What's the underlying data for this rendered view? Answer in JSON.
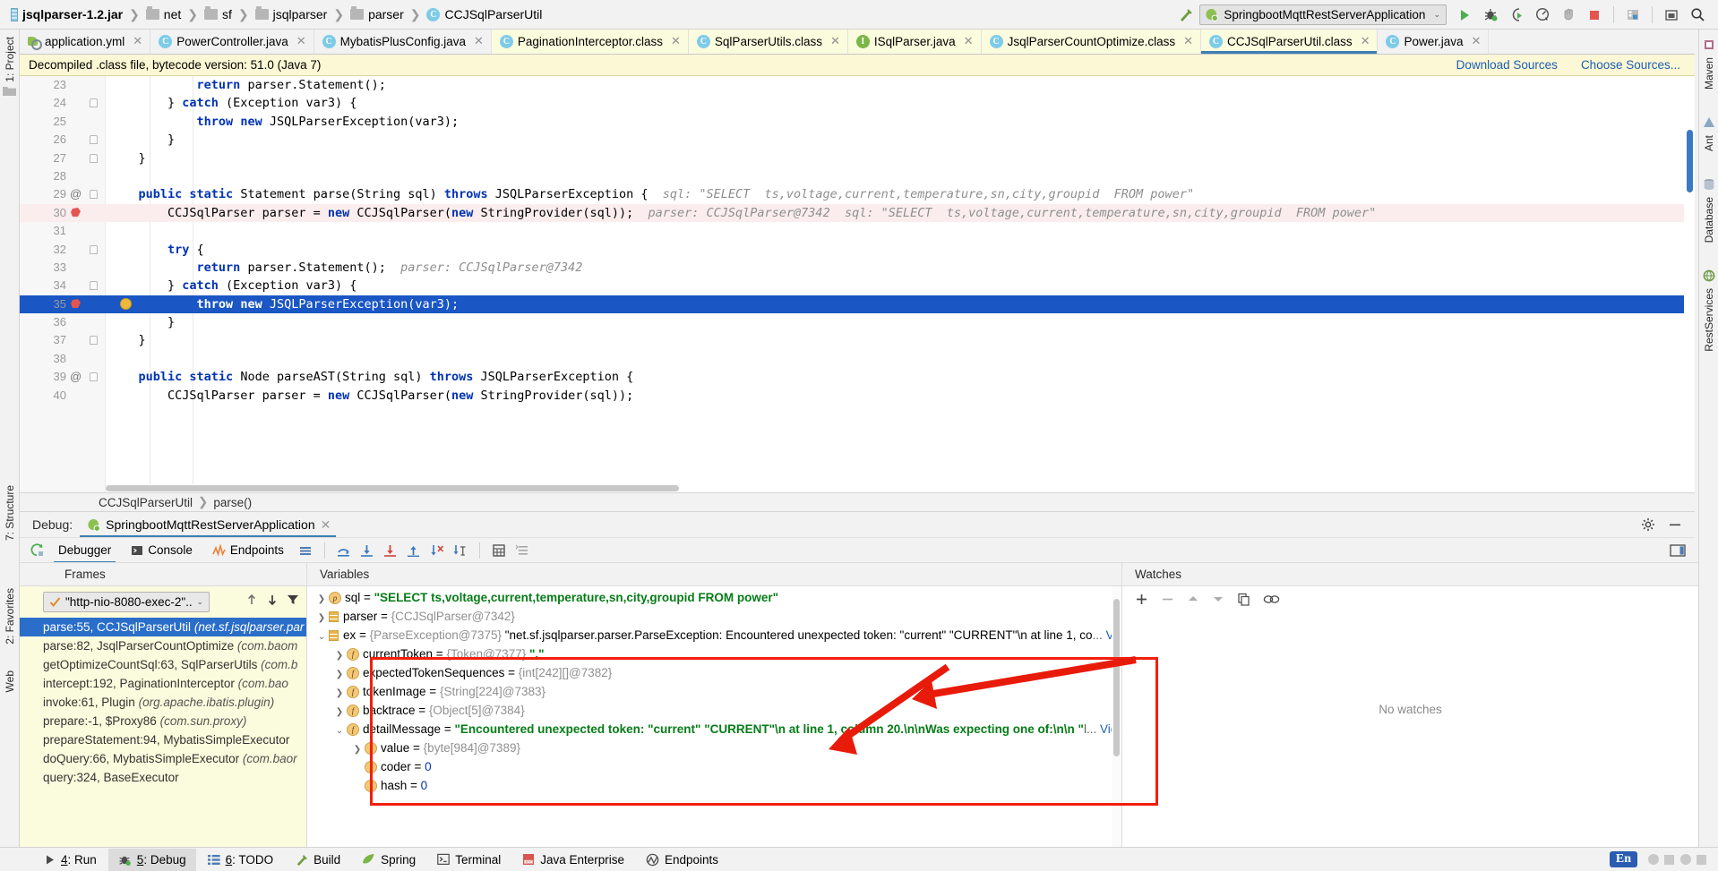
{
  "breadcrumb": {
    "items": [
      {
        "label": "jsqlparser-1.2.jar",
        "icon": "jar-icon"
      },
      {
        "label": "net",
        "icon": "folder-icon"
      },
      {
        "label": "sf",
        "icon": "folder-icon"
      },
      {
        "label": "jsqlparser",
        "icon": "folder-icon"
      },
      {
        "label": "parser",
        "icon": "folder-icon"
      },
      {
        "label": "CCJSqlParserUtil",
        "icon": "class-icon"
      }
    ],
    "separator": "❯"
  },
  "toolbar": {
    "build_icon": "hammer-icon",
    "run_config": "SpringbootMqttRestServerApplication",
    "run_config_icon": "spring-boot-icon",
    "chevron": "⌄",
    "buttons": [
      {
        "name": "run-button",
        "icon": "play-icon"
      },
      {
        "name": "debug-button",
        "icon": "bug-icon"
      },
      {
        "name": "run-with-coverage-button",
        "icon": "run-coverage-icon"
      },
      {
        "name": "profile-button",
        "icon": "profiler-icon"
      },
      {
        "name": "attach-to-process-button",
        "icon": "hand-icon"
      },
      {
        "name": "stop-button",
        "icon": "stop-square-icon"
      },
      {
        "name": "project-structure-button",
        "icon": "project-structure-icon"
      },
      {
        "name": "hide-window-button",
        "icon": "minimize-icon"
      },
      {
        "name": "search-everywhere-button",
        "icon": "search-icon"
      }
    ]
  },
  "editor_tabs": [
    {
      "label": "application.yml",
      "icon": "yml-spring-icon",
      "state": "normal"
    },
    {
      "label": "PowerController.java",
      "icon": "class-icon",
      "state": "normal"
    },
    {
      "label": "MybatisPlusConfig.java",
      "icon": "class-icon",
      "state": "normal"
    },
    {
      "label": "PaginationInterceptor.class",
      "icon": "class-icon",
      "state": "highlight"
    },
    {
      "label": "SqlParserUtils.class",
      "icon": "class-icon",
      "state": "highlight"
    },
    {
      "label": "ISqlParser.java",
      "icon": "interface-icon",
      "state": "highlight"
    },
    {
      "label": "JsqlParserCountOptimize.class",
      "icon": "class-icon",
      "state": "highlight"
    },
    {
      "label": "CCJSqlParserUtil.class",
      "icon": "class-icon",
      "state": "active"
    },
    {
      "label": "Power.java",
      "icon": "class-icon",
      "state": "normal"
    }
  ],
  "notification": {
    "message": "Decompiled .class file, bytecode version: 51.0 (Java 7)",
    "download_sources": "Download Sources",
    "choose_sources": "Choose Sources..."
  },
  "code": {
    "lines": [
      {
        "num": "23",
        "indent": 12,
        "html": "<span class=\"kw\">return</span> parser.Statement();",
        "fold": false
      },
      {
        "num": "24",
        "indent": 8,
        "html": "} <span class=\"kw\">catch</span> (Exception var3) {",
        "fold": "closed"
      },
      {
        "num": "25",
        "indent": 12,
        "html": "<span class=\"kw\">throw</span> <span class=\"kw\">new</span> JSQLParserException(var3);",
        "fold": false
      },
      {
        "num": "26",
        "indent": 8,
        "html": "}",
        "fold": "closed"
      },
      {
        "num": "27",
        "indent": 4,
        "html": "}",
        "fold": "closed"
      },
      {
        "num": "28",
        "indent": 0,
        "html": "",
        "fold": false
      },
      {
        "num": "29",
        "indent": 4,
        "at": "@",
        "fold": "closed",
        "html": "<span class=\"kw\">public static</span> Statement parse(String sql) <span class=\"kw\">throws</span> JSQLParserException {&nbsp;&nbsp;<span class=\"hint\">sql:&nbsp;\"SELECT&nbsp;&nbsp;ts,voltage,current,temperature,sn,city,groupid&nbsp;&nbsp;FROM power\"</span>"
      },
      {
        "num": "30",
        "indent": 8,
        "stamp": "red-stamp-icon",
        "rowstyle": "hlline",
        "html": "CCJSqlParser parser = <span class=\"kw\">new</span> CCJSqlParser(<span class=\"kw\">new</span> StringProvider(sql));&nbsp;&nbsp;<span class=\"hint\">parser:&nbsp;CCJSqlParser@7342&nbsp;&nbsp;sql:&nbsp;\"SELECT&nbsp;&nbsp;ts,voltage,current,temperature,sn,city,groupid&nbsp;&nbsp;FROM power\"</span>"
      },
      {
        "num": "31",
        "indent": 0,
        "html": "",
        "fold": false
      },
      {
        "num": "32",
        "indent": 8,
        "html": "<span class=\"kw\">try</span> {",
        "fold": "closed"
      },
      {
        "num": "33",
        "indent": 12,
        "html": "<span class=\"kw\">return</span> parser.Statement();&nbsp;&nbsp;<span class=\"hint\">parser:&nbsp;CCJSqlParser@7342</span>"
      },
      {
        "num": "34",
        "indent": 8,
        "html": "} <span class=\"kw\">catch</span> (Exception var3) {",
        "fold": "closed"
      },
      {
        "num": "35",
        "indent": 12,
        "stamp": "red-stamp-icon",
        "breakpoint": true,
        "rowstyle": "curline",
        "html": "<span class=\"kw\">throw</span> <span class=\"kw\">new</span> JSQLParserException(var3);"
      },
      {
        "num": "36",
        "indent": 8,
        "html": "}",
        "fold": false
      },
      {
        "num": "37",
        "indent": 4,
        "html": "}",
        "fold": "closed"
      },
      {
        "num": "38",
        "indent": 0,
        "html": "",
        "fold": false
      },
      {
        "num": "39",
        "indent": 4,
        "at": "@",
        "fold": "closed",
        "html": "<span class=\"kw\">public static</span> Node parseAST(String sql) <span class=\"kw\">throws</span> JSQLParserException {"
      },
      {
        "num": "40",
        "indent": 8,
        "html": "CCJSqlParser parser = <span class=\"kw\">new</span> CCJSqlParser(<span class=\"kw\">new</span> StringProvider(sql));"
      }
    ]
  },
  "editor_breadcrumb": {
    "class": "CCJSqlParserUtil",
    "separator": "❯",
    "method": "parse()"
  },
  "debug_panel": {
    "label": "Debug:",
    "session": "SpringbootMqttRestServerApplication",
    "session_icon": "spring-boot-icon",
    "close_icon": "close-icon",
    "settings_icon": "gear-icon",
    "minimize_icon": "minimize-icon",
    "rerun_icon": "rerun-icon",
    "tabs": [
      {
        "label": "Debugger",
        "icon": "none",
        "active": true
      },
      {
        "label": "Console",
        "icon": "console-icon",
        "active": false
      },
      {
        "label": "Endpoints",
        "icon": "endpoints-icon",
        "active": false
      }
    ],
    "step_buttons": [
      {
        "name": "mute-breakpoints-button",
        "icon": "layers-icon"
      },
      {
        "name": "step-over-button",
        "icon": "step-over-icon"
      },
      {
        "name": "step-into-button",
        "icon": "step-into-icon"
      },
      {
        "name": "force-step-into-button",
        "icon": "force-step-into-icon"
      },
      {
        "name": "step-out-button",
        "icon": "step-out-icon"
      },
      {
        "name": "drop-frame-button",
        "icon": "drop-frame-icon"
      },
      {
        "name": "run-to-cursor-button",
        "icon": "run-to-cursor-icon"
      },
      {
        "name": "evaluate-expression-button",
        "icon": "calculator-icon"
      },
      {
        "name": "show-execution-point-button",
        "icon": "execution-point-icon"
      }
    ],
    "layout_icon": "restore-layout-icon"
  },
  "frames": {
    "header": "Frames",
    "thread": "\"http-nio-8080-exec-2\"...",
    "thread_icon": "check-icon",
    "chevron": "⌄",
    "controls": [
      {
        "name": "frames-up-button",
        "icon": "arrow-up-icon"
      },
      {
        "name": "frames-down-button",
        "icon": "arrow-down-icon"
      },
      {
        "name": "frames-filter-button",
        "icon": "filter-icon"
      }
    ],
    "rows": [
      {
        "method": "parse:55, CCJSqlParserUtil",
        "pkg": "(net.sf.jsqlparser.par",
        "selected": true
      },
      {
        "method": "parse:82, JsqlParserCountOptimize",
        "pkg": "(com.baom",
        "selected": false
      },
      {
        "method": "getOptimizeCountSql:63, SqlParserUtils",
        "pkg": "(com.b",
        "selected": false
      },
      {
        "method": "intercept:192, PaginationInterceptor",
        "pkg": "(com.bao",
        "selected": false
      },
      {
        "method": "invoke:61, Plugin",
        "pkg": "(org.apache.ibatis.plugin)",
        "selected": false
      },
      {
        "method": "prepare:-1, $Proxy86",
        "pkg": "(com.sun.proxy)",
        "selected": false
      },
      {
        "method": "prepareStatement:94, MybatisSimpleExecutor",
        "pkg": "",
        "selected": false
      },
      {
        "method": "doQuery:66, MybatisSimpleExecutor",
        "pkg": "(com.baor",
        "selected": false
      },
      {
        "method": "query:324, BaseExecutor",
        "pkg": "",
        "selected": false
      }
    ]
  },
  "variables": {
    "header": "Variables",
    "rows": [
      {
        "indent": 0,
        "twisty": "❯",
        "badge": "p",
        "name": "sql",
        "eq": " = ",
        "value": "\"SELECT  ts,voltage,current,temperature,sn,city,groupid  FROM power\"",
        "vclass": "vstr"
      },
      {
        "indent": 0,
        "twisty": "❯",
        "badge": "local",
        "name": "parser",
        "eq": " = ",
        "value": "{CCJSqlParser@7342}",
        "vclass": "vref"
      },
      {
        "indent": 0,
        "twisty": "⌄",
        "badge": "local",
        "name": "ex",
        "eq": " = ",
        "value": "{ParseException@7375}",
        "vclass": "vref",
        "extra": "\"net.sf.jsqlparser.parser.ParseException: Encountered unexpected token: \"current\" \"CURRENT\"\\n   at line 1, co",
        "extra_class": "vname",
        "ellipsis": "...",
        "link": "View"
      },
      {
        "indent": 1,
        "twisty": "❯",
        "badge": "f",
        "name": "currentToken",
        "eq": " = ",
        "value": "{Token@7377}",
        "vclass": "vref",
        "extra": "\",\"",
        "extra_class": "vstr"
      },
      {
        "indent": 1,
        "twisty": "❯",
        "badge": "f",
        "name": "expectedTokenSequences",
        "eq": " = ",
        "value": "{int[242][]@7382}",
        "vclass": "vref"
      },
      {
        "indent": 1,
        "twisty": "❯",
        "badge": "f",
        "name": "tokenImage",
        "eq": " = ",
        "value": "{String[224]@7383}",
        "vclass": "vref"
      },
      {
        "indent": 1,
        "twisty": "❯",
        "badge": "f",
        "name": "backtrace",
        "eq": " = ",
        "value": "{Object[5]@7384}",
        "vclass": "vref"
      },
      {
        "indent": 1,
        "twisty": "⌄",
        "badge": "f",
        "name": "detailMessage",
        "eq": " = ",
        "value": "\"Encountered unexpected token: \"current\" \"CURRENT\"\\n   at line 1, column 20.\\n\\nWas expecting one of:\\n\\n   \"",
        "vclass": "vstr",
        "ellipsis": "l...",
        "link": "View"
      },
      {
        "indent": 2,
        "twisty": "❯",
        "badge": "f",
        "name": "value",
        "eq": " = ",
        "value": "{byte[984]@7389}",
        "vclass": "vref"
      },
      {
        "indent": 2,
        "twisty": "",
        "badge": "f",
        "name": "coder",
        "eq": " = ",
        "value": "0",
        "vclass": "vnum"
      },
      {
        "indent": 2,
        "twisty": "",
        "badge": "f",
        "name": "hash",
        "eq": " = ",
        "value": "0",
        "vclass": "vnum"
      }
    ]
  },
  "watches": {
    "header": "Watches",
    "empty_text": "No watches",
    "toolbar": [
      {
        "name": "add-watch-button",
        "icon": "plus-icon"
      },
      {
        "name": "remove-watch-button",
        "icon": "minus-icon"
      },
      {
        "name": "move-watch-up-button",
        "icon": "arrow-up-icon"
      },
      {
        "name": "move-watch-down-button",
        "icon": "arrow-down-icon"
      },
      {
        "name": "copy-watch-button",
        "icon": "copy-icon"
      },
      {
        "name": "link-watch-button",
        "icon": "link-icon"
      }
    ]
  },
  "left_strip": {
    "project_label": "1: Project",
    "structure_label": "7: Structure",
    "favorites_label": "2: Favorites",
    "web_label": "Web"
  },
  "right_strip": {
    "items": [
      "Maven",
      "Ant",
      "Database",
      "RestServices"
    ]
  },
  "status_bar": {
    "items": [
      {
        "label": "4: Run",
        "mnemonic": "4",
        "icon": "play-icon",
        "active": false
      },
      {
        "label": "5: Debug",
        "mnemonic": "5",
        "icon": "bug-icon",
        "active": true
      },
      {
        "label": "6: TODO",
        "mnemonic": "6",
        "icon": "todo-icon",
        "active": false
      },
      {
        "label": "Build",
        "mnemonic": "",
        "icon": "hammer-icon",
        "active": false
      },
      {
        "label": "Spring",
        "mnemonic": "",
        "icon": "spring-leaf-icon",
        "active": false
      },
      {
        "label": "Terminal",
        "mnemonic": "",
        "icon": "terminal-icon",
        "active": false
      },
      {
        "label": "Java Enterprise",
        "mnemonic": "",
        "icon": "java-ee-icon",
        "active": false
      },
      {
        "label": "Endpoints",
        "mnemonic": "",
        "icon": "endpoints-icon",
        "active": false
      }
    ],
    "ime": "En"
  },
  "annotation": {
    "box_color": "#f21f0c",
    "arrow_color": "#e81b0b"
  },
  "colors": {
    "accent_blue": "#1a56c4",
    "tab_highlight": "#fbfbdd",
    "notification_bg": "#fcf7d4",
    "string_green": "#067d17",
    "keyword_blue": "#0033b3",
    "selection_blue": "#2a6ec9"
  }
}
